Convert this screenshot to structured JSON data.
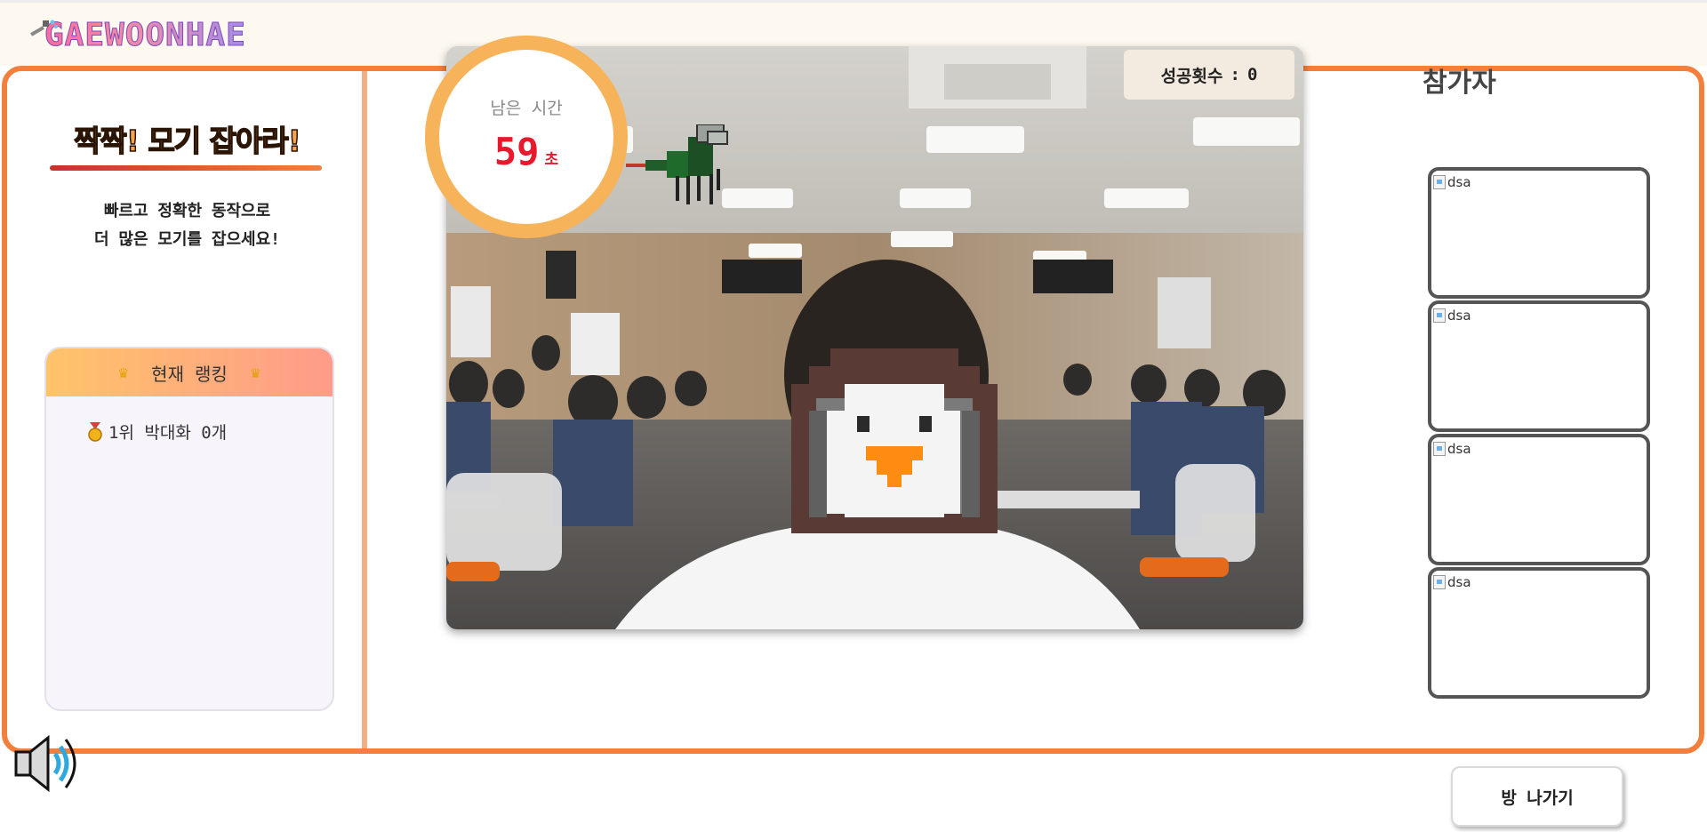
{
  "app": {
    "logo_text": "GAEWOONHAE"
  },
  "game": {
    "title": "짝짝! 모기 잡아라!",
    "desc_line1": "빠르고 정확한 동작으로",
    "desc_line2": "더 많은 모기를 잡으세요!"
  },
  "ranking": {
    "header": "현재 랭킹",
    "items": [
      {
        "text": "1위 박대화 0개"
      }
    ]
  },
  "timer": {
    "label": "남은 시간",
    "value": "59",
    "unit": "초"
  },
  "success": {
    "label": "성공횟수",
    "separator": ":",
    "count": "0"
  },
  "participants": {
    "title": "참가자",
    "slots": [
      {
        "alt": "dsa"
      },
      {
        "alt": "dsa"
      },
      {
        "alt": "dsa"
      },
      {
        "alt": "dsa"
      }
    ]
  },
  "actions": {
    "exit_label": "방 나가기"
  },
  "colors": {
    "accent": "#f47f3c",
    "timer_ring": "#f6b35a",
    "timer_text": "#e8192c"
  }
}
